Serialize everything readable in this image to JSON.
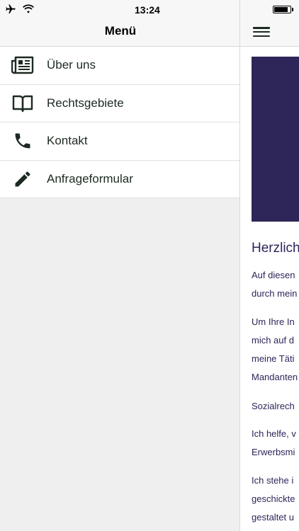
{
  "status_bar": {
    "time": "13:24",
    "battery_level": 0.9
  },
  "drawer": {
    "title": "Menü",
    "items": [
      {
        "label": "Über uns",
        "icon": "newspaper-icon"
      },
      {
        "label": "Rechtsgebiete",
        "icon": "book-icon"
      },
      {
        "label": "Kontakt",
        "icon": "phone-icon"
      },
      {
        "label": "Anfrageformular",
        "icon": "pencil-icon"
      }
    ]
  },
  "content": {
    "heading": "Herzlich",
    "paragraphs": [
      [
        "Auf diesen",
        "durch mein"
      ],
      [
        "Um Ihre In",
        "mich auf d",
        "meine Täti",
        "Mandanten"
      ],
      [
        "Sozialrech"
      ],
      [
        "Ich helfe, v",
        "Erwerbsmi"
      ],
      [
        "Ich stehe i",
        "geschickte",
        "gestaltet  u"
      ]
    ]
  },
  "colors": {
    "accent": "#2e2559",
    "icon": "#1d2a21",
    "background": "#efefef"
  }
}
